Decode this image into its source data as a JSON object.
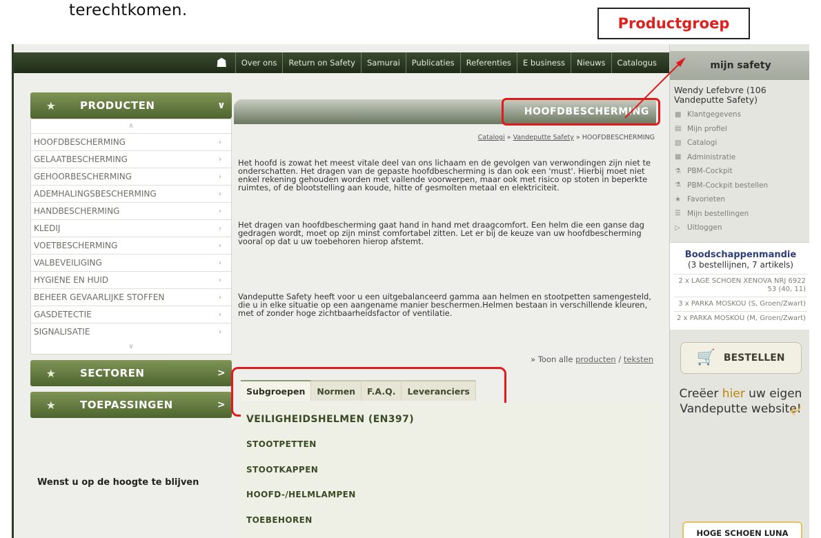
{
  "doc": {
    "top_text": "terechtkomen."
  },
  "callout": {
    "label": "Productgroep"
  },
  "topnav": {
    "items": [
      "Over ons",
      "Return on Safety",
      "Samurai",
      "Publicaties",
      "Referenties",
      "E business",
      "Nieuws",
      "Catalogus"
    ]
  },
  "right": {
    "title": "mijn safety",
    "user": "Wendy Lefebvre (106 Vandeputte Safety)",
    "menu": [
      {
        "label": "Klantgegevens",
        "icon": "people-icon"
      },
      {
        "label": "Mijn profiel",
        "icon": "id-card-icon"
      },
      {
        "label": "Catalogi",
        "icon": "book-icon"
      },
      {
        "label": "Administratie",
        "icon": "document-icon"
      },
      {
        "label": "PBM-Cockpit",
        "icon": "cockpit-icon"
      },
      {
        "label": "PBM-Cockpit bestellen",
        "icon": "cockpit-order-icon"
      },
      {
        "label": "Favorieten",
        "icon": "star-icon"
      },
      {
        "label": "Mijn bestellingen",
        "icon": "list-icon"
      },
      {
        "label": "Uitloggen",
        "icon": "logout-icon"
      }
    ],
    "basket": {
      "title": "Boodschappenmandie",
      "subtitle": "(3 bestellijnen, 7 artikels)",
      "orders": [
        "2 x LAGE SCHOEN XENOVA NRJ 6922 53 (40, 11)",
        "3 x PARKA MOSKOU (S, Groen/Zwart)",
        "2 x PARKA MOSKOU (M, Groen/Zwart)"
      ]
    },
    "bestellen": "BESTELLEN",
    "promo": {
      "before": "Creëer",
      "highlight": "hier",
      "after": "uw eigen Vandeputte website!"
    },
    "luna": "HOGE SCHOEN LUNA"
  },
  "sidebar": {
    "producten": "PRODUCTEN",
    "products": [
      "HOOFDBESCHERMING",
      "GELAATBESCHERMING",
      "GEHOORBESCHERMING",
      "ADEMHALINGSBESCHERMING",
      "HANDBESCHERMING",
      "KLEDIJ",
      "VOETBESCHERMING",
      "VALBEVEILIGING",
      "HYGIENE EN HUID",
      "BEHEER GEVAARLIJKE STOFFEN",
      "GASDETECTIE",
      "SIGNALISATIE"
    ],
    "sectoren": "SECTOREN",
    "toepassingen": "TOEPASSINGEN",
    "wenst": "Wenst u op de hoogte te blijven"
  },
  "main": {
    "banner": "HOOFDBESCHERMING",
    "breadcrumb": {
      "c1": "Catalogi",
      "c2": "Vandeputte Safety",
      "c3": "HOOFDBESCHERMING",
      "sep": "»"
    },
    "p1": "Het hoofd is zowat het meest vitale deel van ons lichaam en de gevolgen van verwondingen zijn niet te onderschatten. Het dragen van de gepaste hoofdbescherming is dan ook een 'must'. Hierbij moet niet enkel rekening gehouden worden met vallende voorwerpen, maar ook met risico op stoten in beperkte ruimtes, of de blootstelling aan koude, hitte of gesmolten metaal en elektriciteit.",
    "p2": "Het dragen van hoofdbescherming gaat hand in hand met draagcomfort. Een helm die een ganse dag gedragen wordt, moet op zijn minst comfortabel zitten. Let er bij de keuze van uw hoofdbescherming vooral op dat u uw toebehoren hierop afstemt.",
    "p3": "Vandeputte Safety heeft voor u een uitgebalanceerd gamma aan helmen en stootpetten samengesteld, die u in elke situatie op een aangename manier beschermen.Helmen bestaan in verschillende kleuren, met of zonder hoge zichtbaarheidsfactor of ventilatie.",
    "toon": {
      "prefix": "» Toon alle",
      "producten": "producten",
      "sep": "/",
      "teksten": "teksten"
    },
    "tabs": [
      "Subgroepen",
      "Normen",
      "F.A.Q.",
      "Leveranciers"
    ],
    "subgroups": [
      "VEILIGHEIDSHELMEN (EN397)",
      "STOOTPETTEN",
      "STOOTKAPPEN",
      "HOOFD-/HELMLAMPEN",
      "TOEBEHOREN"
    ]
  },
  "colors": {
    "highlight_red": "#e01b1b",
    "nav_green": "#2b3b24",
    "button_green": "#5e7638"
  }
}
